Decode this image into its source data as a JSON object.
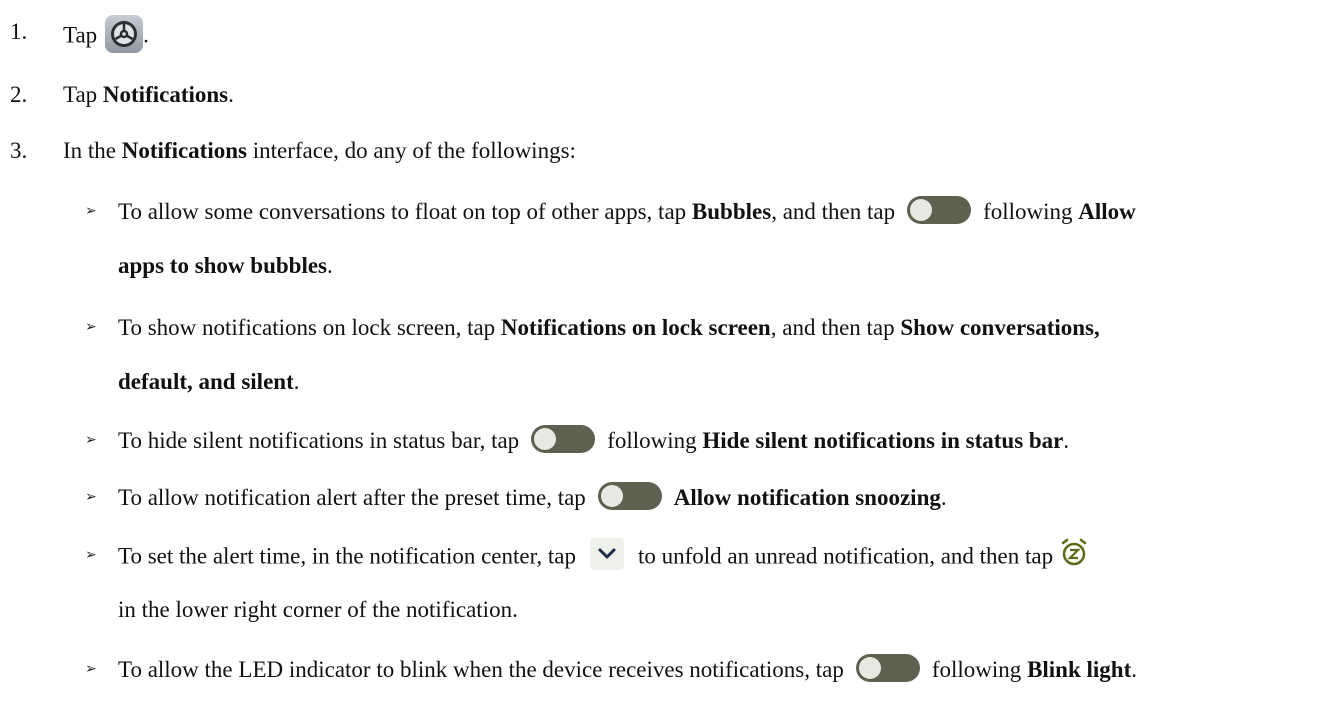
{
  "steps": [
    {
      "num": "1.",
      "pre": "Tap",
      "post": "."
    },
    {
      "num": "2.",
      "pre": "Tap ",
      "bold": "Notifications",
      "post": "."
    },
    {
      "num": "3.",
      "pre": "In the ",
      "bold": "Notifications",
      "post": " interface, do any of the followings:"
    }
  ],
  "bullets": {
    "bubbles": {
      "pre": "To allow some conversations to float on top of other apps, tap ",
      "bold1": "Bubbles",
      "mid": ", and then tap",
      "after_icon": "following ",
      "bold2": "Allow",
      "bold2_cont": "apps to show bubbles",
      "end": "."
    },
    "lock_screen": {
      "pre": "To show notifications on lock screen, tap ",
      "bold1": "Notifications on lock screen",
      "mid": ", and then tap ",
      "bold2": "Show conversations,",
      "bold2_cont": "default, and silent",
      "end": "."
    },
    "silent": {
      "pre": "To hide silent notifications in status bar, tap",
      "after_icon": "following ",
      "bold": "Hide silent notifications in status bar",
      "end": "."
    },
    "snooze": {
      "pre": "To allow notification alert after the preset time, tap",
      "bold": "Allow notification snoozing",
      "end": "."
    },
    "alert_time": {
      "pre": "To set the alert time, in the notification center, tap",
      "mid": "to unfold an unread notification, and then tap",
      "cont": "in the lower right corner of the notification."
    },
    "led": {
      "pre": "To allow the LED indicator to blink when the device receives notifications, tap",
      "after_icon": "following ",
      "bold": "Blink light",
      "end": "."
    }
  },
  "bullet_glyph": "➢",
  "icons": {
    "settings": "settings-gear-icon",
    "toggle": "toggle-switch-icon",
    "chevron": "chevron-down-icon",
    "snooze": "snooze-alarm-icon"
  },
  "colors": {
    "toggle_track": "#5e6150",
    "snooze_green": "#5a6b1a"
  }
}
